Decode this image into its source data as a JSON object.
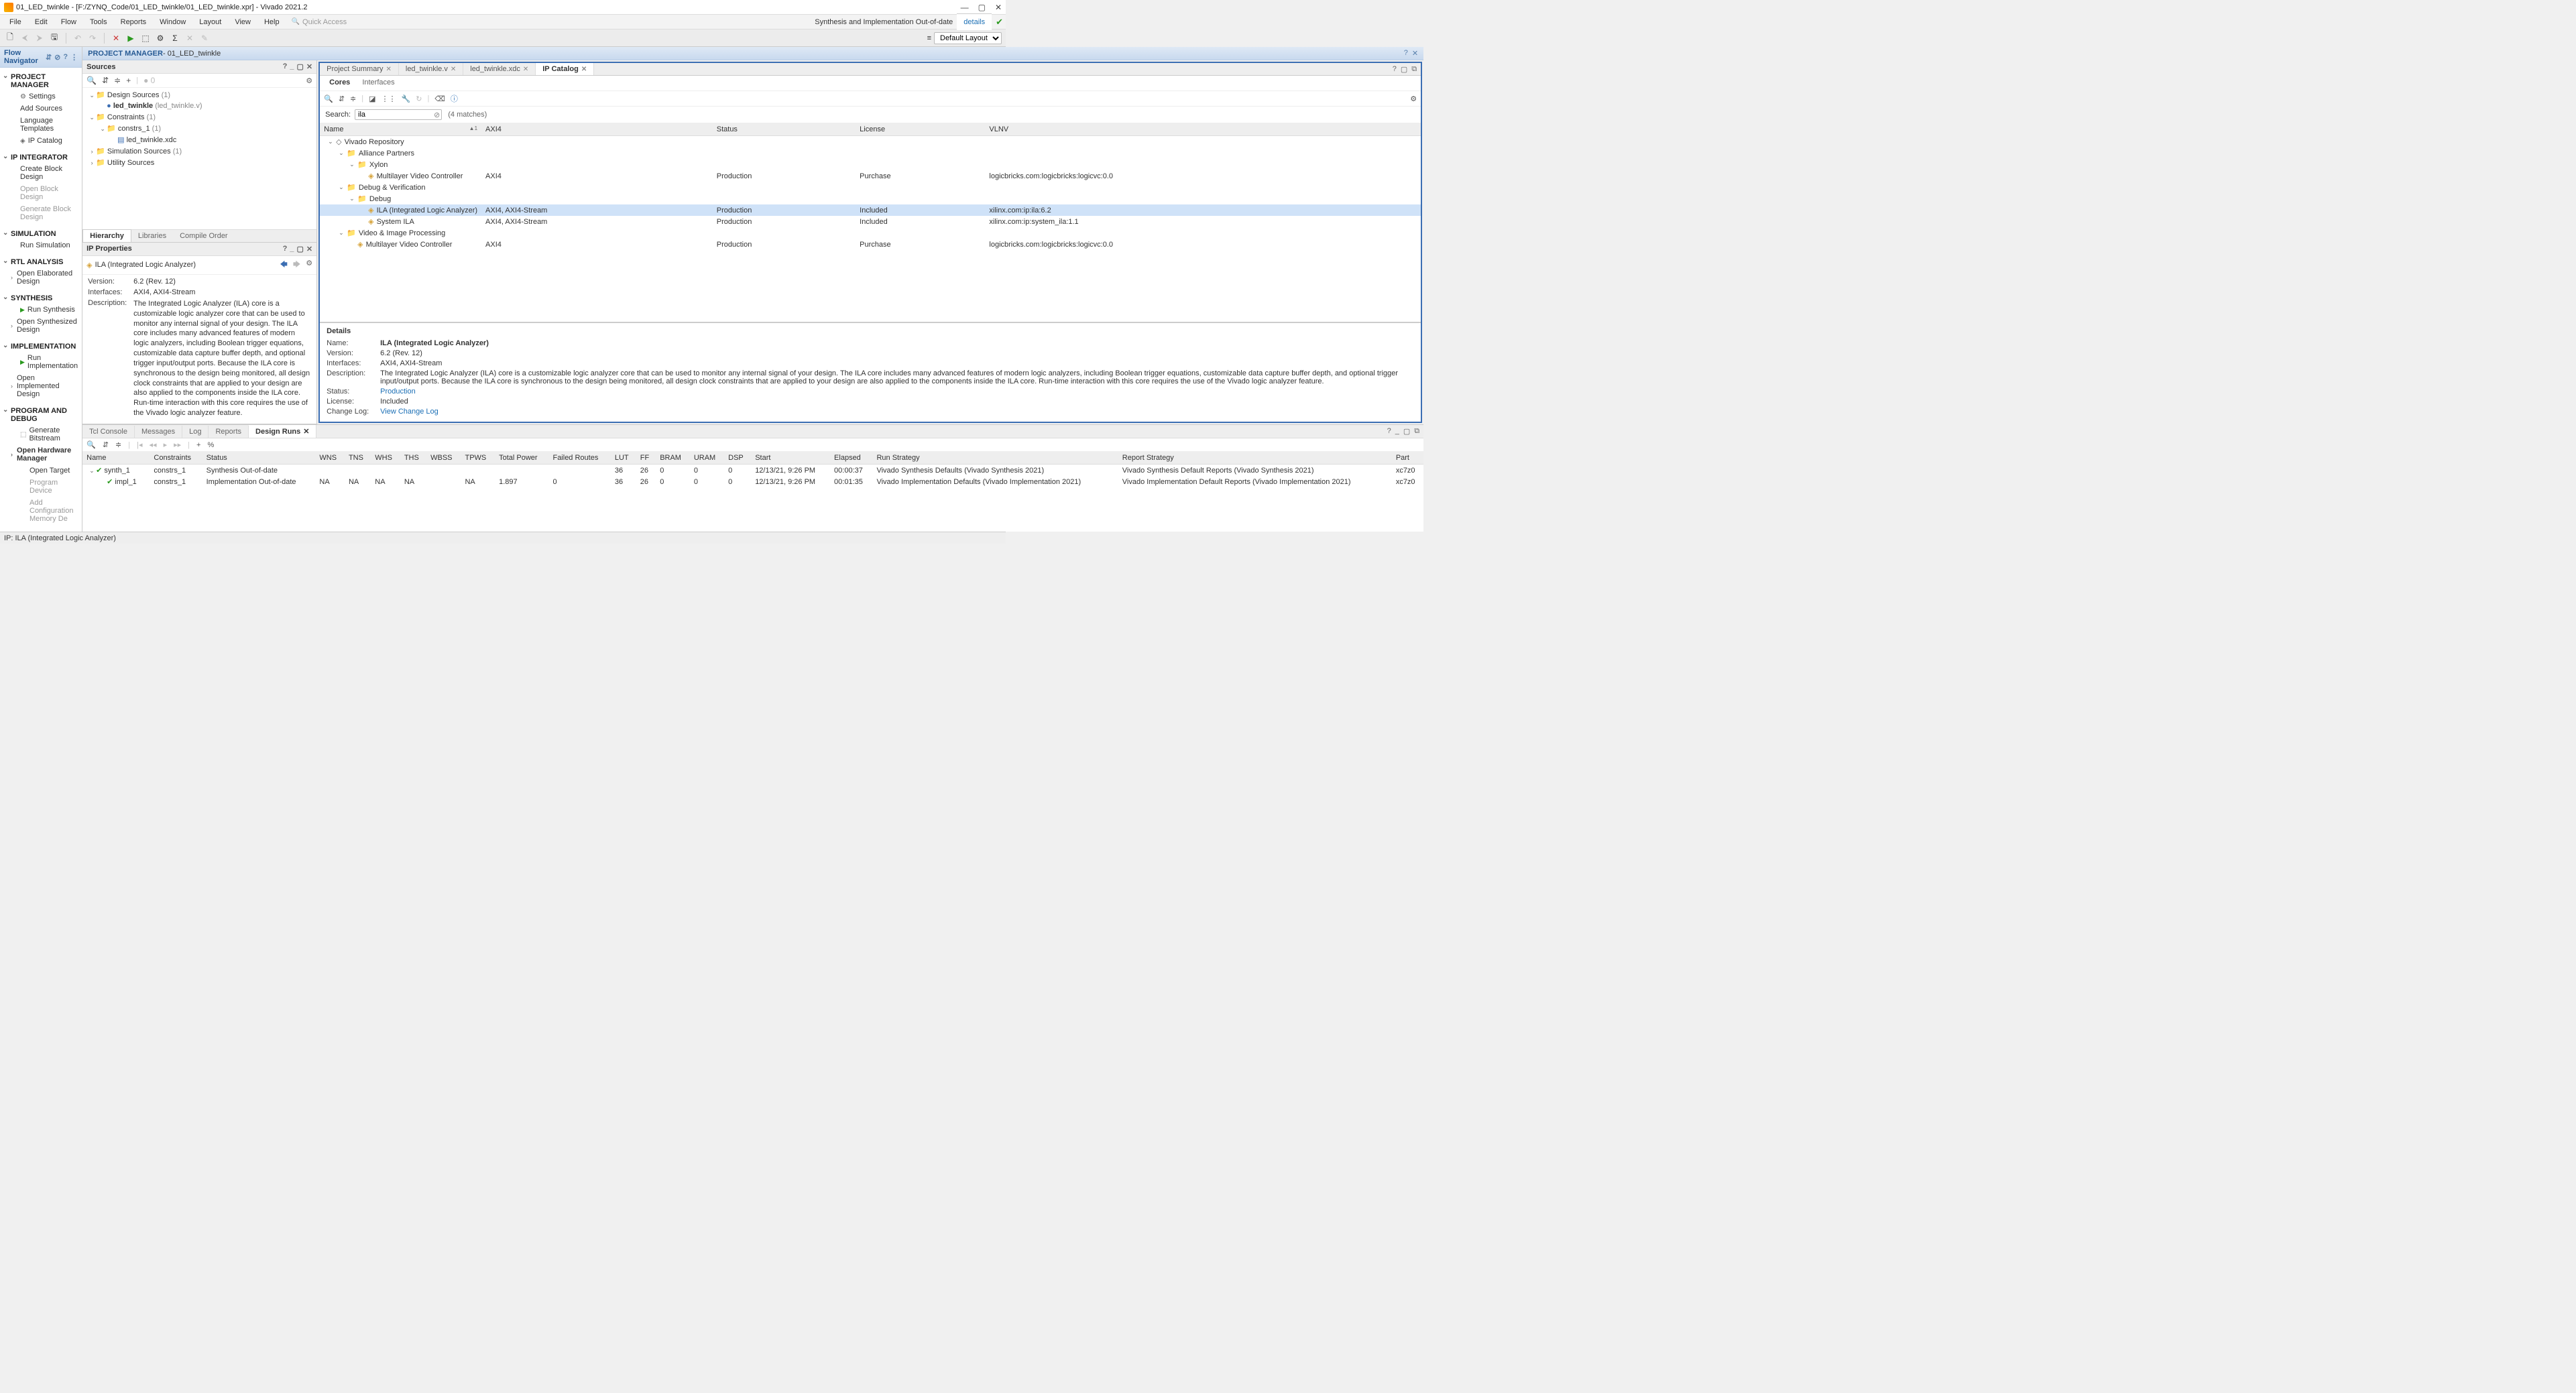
{
  "window": {
    "title": "01_LED_twinkle - [F:/ZYNQ_Code/01_LED_twinkle/01_LED_twinkle.xpr] - Vivado 2021.2"
  },
  "menubar": {
    "items": [
      "File",
      "Edit",
      "Flow",
      "Tools",
      "Reports",
      "Window",
      "Layout",
      "View",
      "Help"
    ],
    "quick": "Quick Access",
    "status": "Synthesis and Implementation Out-of-date",
    "details": "details",
    "layout_label": "Default Layout"
  },
  "flownav": {
    "title": "Flow Navigator",
    "sections": [
      {
        "title": "PROJECT MANAGER",
        "items": [
          {
            "label": "Settings",
            "icon": "⚙"
          },
          {
            "label": "Add Sources"
          },
          {
            "label": "Language Templates"
          },
          {
            "label": "IP Catalog",
            "icon": "◈"
          }
        ]
      },
      {
        "title": "IP INTEGRATOR",
        "items": [
          {
            "label": "Create Block Design"
          },
          {
            "label": "Open Block Design",
            "disabled": true
          },
          {
            "label": "Generate Block Design",
            "disabled": true
          }
        ]
      },
      {
        "title": "SIMULATION",
        "items": [
          {
            "label": "Run Simulation"
          }
        ]
      },
      {
        "title": "RTL ANALYSIS",
        "items": [
          {
            "label": "Open Elaborated Design",
            "chev": true
          }
        ]
      },
      {
        "title": "SYNTHESIS",
        "items": [
          {
            "label": "Run Synthesis",
            "run": true
          },
          {
            "label": "Open Synthesized Design",
            "chev": true
          }
        ]
      },
      {
        "title": "IMPLEMENTATION",
        "items": [
          {
            "label": "Run Implementation",
            "run": true
          },
          {
            "label": "Open Implemented Design",
            "chev": true
          }
        ]
      },
      {
        "title": "PROGRAM AND DEBUG",
        "items": [
          {
            "label": "Generate Bitstream",
            "icon": "⬚"
          },
          {
            "label": "Open Hardware Manager",
            "chev": true,
            "bold": true
          },
          {
            "label": "Open Target",
            "sub": true
          },
          {
            "label": "Program Device",
            "sub": true,
            "disabled": true
          },
          {
            "label": "Add Configuration Memory De",
            "sub": true,
            "disabled": true
          }
        ]
      }
    ]
  },
  "projmgr": {
    "title": "PROJECT MANAGER",
    "suffix": " - 01_LED_twinkle"
  },
  "sources": {
    "title": "Sources",
    "tabs": [
      "Hierarchy",
      "Libraries",
      "Compile Order"
    ],
    "tree": [
      {
        "d": 0,
        "tw": "⌄",
        "icon": "📁",
        "label": "Design Sources",
        "count": "(1)"
      },
      {
        "d": 1,
        "tw": "",
        "icon": "●",
        "label": "led_twinkle",
        "dim": "(led_twinkle.v)",
        "top": true
      },
      {
        "d": 0,
        "tw": "⌄",
        "icon": "📁",
        "label": "Constraints",
        "count": "(1)"
      },
      {
        "d": 1,
        "tw": "⌄",
        "icon": "📁",
        "label": "constrs_1",
        "count": "(1)"
      },
      {
        "d": 2,
        "tw": "",
        "icon": "▤",
        "label": "led_twinkle.xdc"
      },
      {
        "d": 0,
        "tw": "›",
        "icon": "📁",
        "label": "Simulation Sources",
        "count": "(1)"
      },
      {
        "d": 0,
        "tw": "›",
        "icon": "📁",
        "label": "Utility Sources"
      }
    ]
  },
  "ipprops": {
    "title": "IP Properties",
    "name": "ILA (Integrated Logic Analyzer)",
    "version_k": "Version:",
    "version": "6.2 (Rev. 12)",
    "interfaces_k": "Interfaces:",
    "interfaces": "AXI4, AXI4-Stream",
    "description_k": "Description:",
    "description": "The Integrated Logic Analyzer (ILA) core is a customizable logic analyzer core that can be used to monitor any internal signal of your design. The ILA core includes many advanced features of modern logic analyzers, including Boolean trigger equations, customizable data capture buffer depth, and optional trigger input/output ports. Because the ILA core is synchronous to the design being monitored, all design clock constraints that are applied to your design are also applied to the components inside the ILA core. Run-time interaction with this core requires the use of the Vivado logic analyzer feature."
  },
  "catalog": {
    "tabs": [
      {
        "label": "Project Summary",
        "close": true
      },
      {
        "label": "led_twinkle.v",
        "close": true
      },
      {
        "label": "led_twinkle.xdc",
        "close": true
      },
      {
        "label": "IP Catalog",
        "close": true,
        "active": true
      }
    ],
    "subtabs": [
      "Cores",
      "Interfaces"
    ],
    "search_label": "Search:",
    "search": "ila",
    "matches": "(4 matches)",
    "cols": [
      "Name",
      "AXI4",
      "Status",
      "License",
      "VLNV"
    ],
    "rows": [
      {
        "d": 0,
        "tw": "⌄",
        "icon": "◇",
        "label": "Vivado Repository"
      },
      {
        "d": 1,
        "tw": "⌄",
        "icon": "📁",
        "label": "Alliance Partners"
      },
      {
        "d": 2,
        "tw": "⌄",
        "icon": "📁",
        "label": "Xylon"
      },
      {
        "d": 3,
        "tw": "",
        "icon": "◈",
        "label": "Multilayer Video Controller",
        "axi": "AXI4",
        "status": "Production",
        "lic": "Purchase",
        "vlnv": "logicbricks.com:logicbricks:logicvc:0.0"
      },
      {
        "d": 1,
        "tw": "⌄",
        "icon": "📁",
        "label": "Debug & Verification"
      },
      {
        "d": 2,
        "tw": "⌄",
        "icon": "📁",
        "label": "Debug"
      },
      {
        "d": 3,
        "tw": "",
        "icon": "◈",
        "label": "ILA (Integrated Logic Analyzer)",
        "axi": "AXI4, AXI4-Stream",
        "status": "Production",
        "lic": "Included",
        "vlnv": "xilinx.com:ip:ila:6.2",
        "sel": true
      },
      {
        "d": 3,
        "tw": "",
        "icon": "◈",
        "label": "System ILA",
        "axi": "AXI4, AXI4-Stream",
        "status": "Production",
        "lic": "Included",
        "vlnv": "xilinx.com:ip:system_ila:1.1"
      },
      {
        "d": 1,
        "tw": "⌄",
        "icon": "📁",
        "label": "Video & Image Processing"
      },
      {
        "d": 2,
        "tw": "",
        "icon": "◈",
        "label": "Multilayer Video Controller",
        "axi": "AXI4",
        "status": "Production",
        "lic": "Purchase",
        "vlnv": "logicbricks.com:logicbricks:logicvc:0.0"
      }
    ]
  },
  "details": {
    "title": "Details",
    "name_k": "Name:",
    "name": "ILA (Integrated Logic Analyzer)",
    "version_k": "Version:",
    "version": "6.2 (Rev. 12)",
    "interfaces_k": "Interfaces:",
    "interfaces": "AXI4, AXI4-Stream",
    "description_k": "Description:",
    "description": "The Integrated Logic Analyzer (ILA) core is a customizable logic analyzer core that can be used to monitor any internal signal of your design. The ILA core includes many advanced features of modern logic analyzers, including Boolean trigger equations, customizable data capture buffer depth, and optional trigger input/output ports.  Because the ILA core is synchronous to the design being monitored, all design clock constraints that are applied to your design are also applied to the components inside the ILA core. Run-time interaction with this core requires the use of the Vivado logic analyzer feature.",
    "status_k": "Status:",
    "status": "Production",
    "license_k": "License:",
    "license": "Included",
    "changelog_k": "Change Log:",
    "changelog": "View Change Log"
  },
  "bottom": {
    "tabs": [
      "Tcl Console",
      "Messages",
      "Log",
      "Reports",
      "Design Runs"
    ],
    "active": "Design Runs",
    "cols": [
      "Name",
      "Constraints",
      "Status",
      "WNS",
      "TNS",
      "WHS",
      "THS",
      "WBSS",
      "TPWS",
      "Total Power",
      "Failed Routes",
      "LUT",
      "FF",
      "BRAM",
      "URAM",
      "DSP",
      "Start",
      "Elapsed",
      "Run Strategy",
      "Report Strategy",
      "Part"
    ],
    "rows": [
      {
        "name": "synth_1",
        "tw": "⌄",
        "ok": true,
        "constraints": "constrs_1",
        "status": "Synthesis Out-of-date",
        "wns": "",
        "tns": "",
        "whs": "",
        "ths": "",
        "wbss": "",
        "tpws": "",
        "power": "",
        "routes": "",
        "lut": "36",
        "ff": "26",
        "bram": "0",
        "uram": "0",
        "dsp": "0",
        "start": "12/13/21, 9:26 PM",
        "elapsed": "00:00:37",
        "strategy": "Vivado Synthesis Defaults (Vivado Synthesis 2021)",
        "report": "Vivado Synthesis Default Reports (Vivado Synthesis 2021)",
        "part": "xc7z0"
      },
      {
        "name": "impl_1",
        "tw": "",
        "ok": true,
        "constraints": "constrs_1",
        "status": "Implementation Out-of-date",
        "wns": "NA",
        "tns": "NA",
        "whs": "NA",
        "ths": "NA",
        "wbss": "",
        "tpws": "NA",
        "power": "1.897",
        "routes": "0",
        "lut": "36",
        "ff": "26",
        "bram": "0",
        "uram": "0",
        "dsp": "0",
        "start": "12/13/21, 9:26 PM",
        "elapsed": "00:01:35",
        "strategy": "Vivado Implementation Defaults (Vivado Implementation 2021)",
        "report": "Vivado Implementation Default Reports (Vivado Implementation 2021)",
        "part": "xc7z0",
        "sub": true
      }
    ]
  },
  "statusbar": {
    "text": "IP: ILA (Integrated Logic Analyzer)"
  }
}
